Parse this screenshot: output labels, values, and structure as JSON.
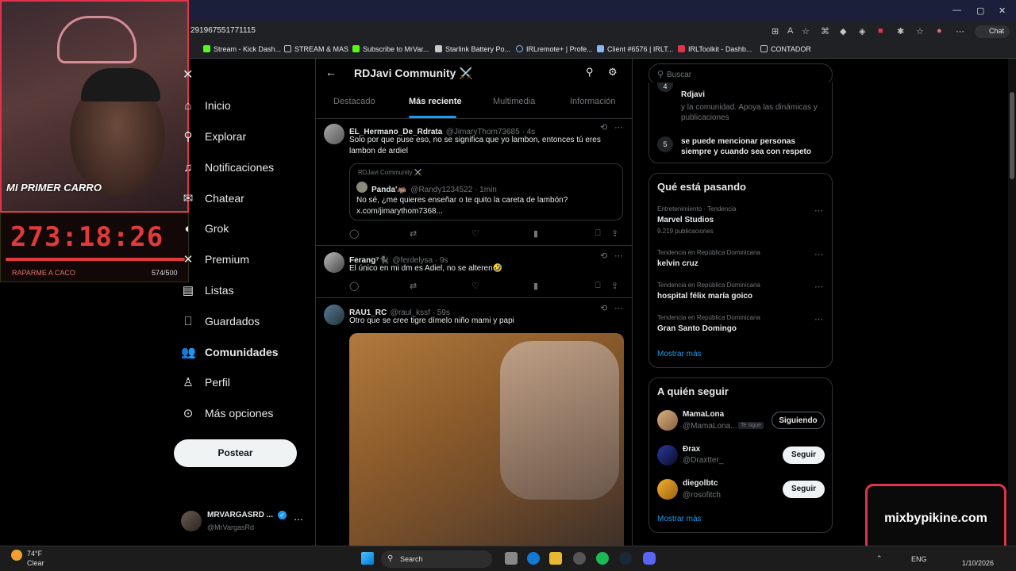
{
  "browser": {
    "url": "291967551771115",
    "chat_label": "Chat",
    "bookmarks": [
      {
        "label": "Stream - Kick Dash...",
        "color": "#53fc18"
      },
      {
        "label": "STREAM & MAS",
        "color": "#c4c7c5"
      },
      {
        "label": "Subscribe to MrVar...",
        "color": "#53fc18"
      },
      {
        "label": "Starlink Battery Po...",
        "color": "#c4c7c5"
      },
      {
        "label": "IRLremote+ | Profe...",
        "color": "#8ab4f8"
      },
      {
        "label": "Client #6576 | IRLT...",
        "color": "#8ab4f8"
      },
      {
        "label": "IRLToolkit - Dashb...",
        "color": "#e0344a"
      },
      {
        "label": "CONTADOR",
        "color": "#c4c7c5"
      }
    ]
  },
  "stream_overlay": {
    "cam_text": "MI PRIMER CARRO",
    "timer": "273:18:26",
    "goal_label": "RAPARME A CACO",
    "goal_count": "574/500",
    "brand": "mixbypikine.com"
  },
  "nav": {
    "items": [
      {
        "label": "Inicio",
        "icon": "home-icon"
      },
      {
        "label": "Explorar",
        "icon": "search-icon"
      },
      {
        "label": "Notificaciones",
        "icon": "bell-icon"
      },
      {
        "label": "Chatear",
        "icon": "mail-icon"
      },
      {
        "label": "Grok",
        "icon": "grok-icon"
      },
      {
        "label": "Premium",
        "icon": "x-logo-icon"
      },
      {
        "label": "Listas",
        "icon": "list-icon"
      },
      {
        "label": "Guardados",
        "icon": "bookmark-icon"
      },
      {
        "label": "Comunidades",
        "icon": "people-icon"
      },
      {
        "label": "Perfil",
        "icon": "person-icon"
      },
      {
        "label": "Más opciones",
        "icon": "more-circle-icon"
      }
    ],
    "post_button": "Postear",
    "account": {
      "name": "MRVARGASRD ...",
      "handle": "@MrVargasRd"
    }
  },
  "community": {
    "title": "RDJavi Community ⚔️",
    "tabs": [
      "Destacado",
      "Más reciente",
      "Multimedia",
      "Información"
    ],
    "active_tab": "Más reciente"
  },
  "posts": [
    {
      "name": "EL_Hermano_De_Rdrata",
      "handle": "@JimaryThom73685 · 4s",
      "text": "Solo por que puse eso, no se significa que yo lambon, entonces tú eres lambon de ardiel",
      "quote": {
        "community": "RDJavi Community ⚔️",
        "name": "Panda'🦛",
        "handle": "@Randy1234522 · 1min",
        "text": "No sé, ¿me quieres enseñar o te quito la careta de lambón?",
        "link": "x.com/jimarythom7368..."
      }
    },
    {
      "name": "Ferang⁷🐈‍⬛",
      "handle": "@ferdelysa · 9s",
      "text": "El único en mi dm es Adiel, no se alteren🤣"
    },
    {
      "name": "RAU1_RC",
      "handle": "@raul_kssf · 59s",
      "text": "Otro que se cree tigre dímelo niño mami y papi"
    }
  ],
  "right": {
    "search_placeholder": "Buscar",
    "rules": [
      {
        "num": "4",
        "title": "Rdjavi",
        "desc": "y la comunidad. Apoya las dinámicas y publicaciones"
      },
      {
        "num": "5",
        "title": "se puede mencionar personas siempre y cuando sea con respeto",
        "desc": ""
      }
    ],
    "trends_title": "Qué está pasando",
    "trends": [
      {
        "meta": "Entretenimiento · Tendencia",
        "name": "Marvel Studios",
        "count": "9.219 publicaciones"
      },
      {
        "meta": "Tendencia en República Dominicana",
        "name": "kelvin cruz",
        "count": ""
      },
      {
        "meta": "Tendencia en República Dominicana",
        "name": "hospital félix maría goico",
        "count": ""
      },
      {
        "meta": "Tendencia en República Dominicana",
        "name": "Gran Santo Domingo",
        "count": ""
      }
    ],
    "show_more": "Mostrar más",
    "follow_title": "A quién seguir",
    "follow": [
      {
        "name": "MamaLona",
        "handle": "@MamaLona...",
        "badge": "Te sigue",
        "button": "Siguiendo"
      },
      {
        "name": "Ðrax",
        "handle": "@Draxtter_",
        "badge": "",
        "button": "Seguir"
      },
      {
        "name": "diegolbtc",
        "handle": "@rosofitch",
        "badge": "",
        "button": "Seguir"
      }
    ],
    "show_more_2": "Mostrar más"
  },
  "taskbar": {
    "weather_temp": "74°F",
    "weather_cond": "Clear",
    "search": "Search",
    "lang": "ENG",
    "date": "1/10/2026"
  }
}
